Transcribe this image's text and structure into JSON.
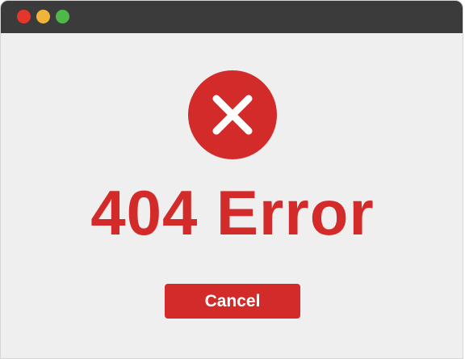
{
  "window": {
    "controls": [
      "close",
      "minimize",
      "maximize"
    ]
  },
  "dialog": {
    "icon": "close-x-icon",
    "title": "404 Error",
    "cancel_label": "Cancel"
  },
  "colors": {
    "titlebar": "#3b3b3b",
    "background": "#efefef",
    "accent": "#d32a2a",
    "close_dot": "#e5352d",
    "minimize_dot": "#f1b43a",
    "maximize_dot": "#4fb848"
  }
}
